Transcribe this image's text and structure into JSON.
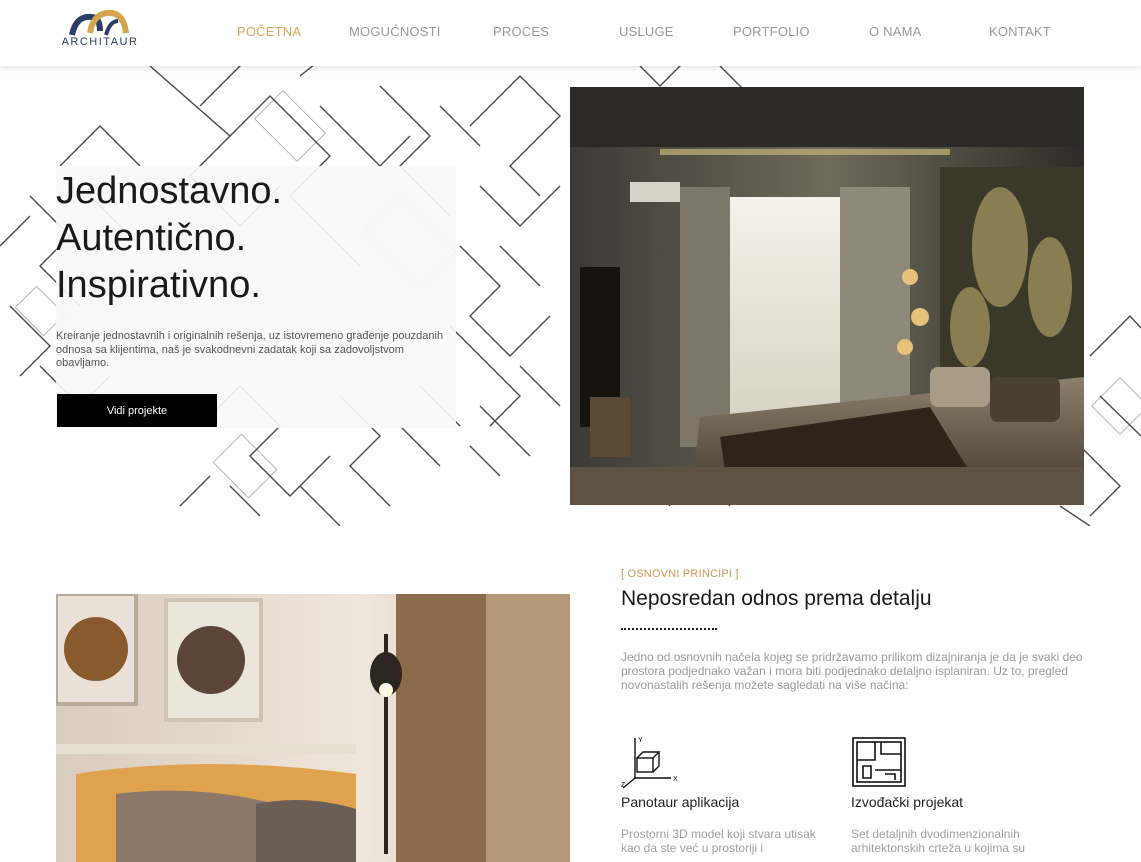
{
  "brand": {
    "logo_text": "ARCHITAUR"
  },
  "nav": {
    "items": [
      {
        "label": "POČETNA",
        "active": true
      },
      {
        "label": "MOGUĆNOSTI"
      },
      {
        "label": "PROCES"
      },
      {
        "label": "USLUGE"
      },
      {
        "label": "PORTFOLIO"
      },
      {
        "label": "O NAMA"
      },
      {
        "label": "KONTAKT"
      }
    ],
    "active_color": "#d9a65a",
    "inactive_color": "#999999"
  },
  "hero": {
    "title_lines": [
      "Jednostavno.",
      "Autentično.",
      "Inspirativno."
    ],
    "text": "Kreiranje jednostavnih i originalnih rešenja, uz istovremeno građenje pouzdanih odnosa sa klijentima, naš je svakodnevni zadatak koji sa zadovoljstvom obavljamo.",
    "button_label": "Vidi projekte"
  },
  "principles": {
    "kicker": "[ OSNOVNI PRINCIPI ]",
    "title": "Neposredan odnos prema detalju",
    "text": "Jedno od osnovnih načela kojeg se pridržavamo prilikom dizajniranja je da je svaki deo prostora podjednako važan i mora biti podjednako detaljno isplaniran. Uz to, pregled novonastalih rešenja možete sagledati na više načina:",
    "features": [
      {
        "icon": "3d-axes-cube-icon",
        "title": "Panotaur aplikacija",
        "text": "Prostorni 3D model koji stvara utisak kao da ste već u prostoriji i"
      },
      {
        "icon": "floor-plan-icon",
        "title": "Izvođački projekat",
        "text": "Set detaljnih dvodimenzionalnih arhitektonskih crteža u kojima su"
      }
    ]
  }
}
